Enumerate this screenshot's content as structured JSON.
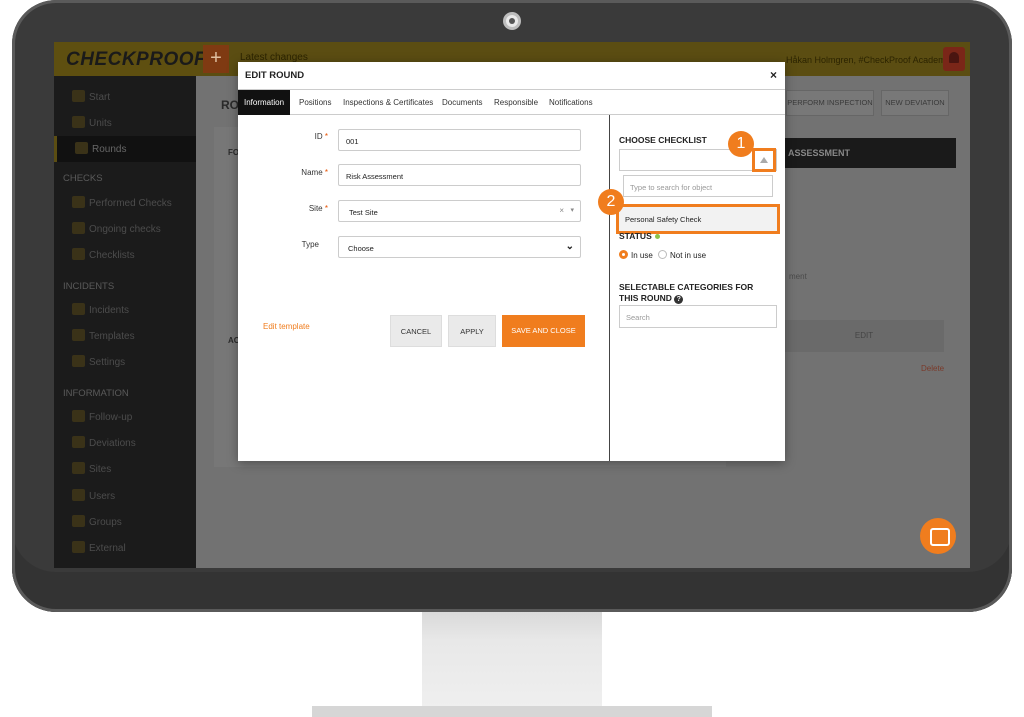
{
  "app": {
    "logo": "CHECKPROOF",
    "latest_changes": "Latest changes",
    "user": "Håkan Holmgren, #CheckProof Academy ▾",
    "plus": "+"
  },
  "sidebar": {
    "items": [
      {
        "label": "Start",
        "icon": "home-icon"
      },
      {
        "label": "Units",
        "icon": "truck-icon"
      },
      {
        "label": "Rounds",
        "icon": "route-icon"
      },
      {
        "label": "Performed Checks",
        "icon": "check-circle-icon"
      },
      {
        "label": "Ongoing checks",
        "icon": "clipboard-icon"
      },
      {
        "label": "Checklists",
        "icon": "list-icon"
      },
      {
        "label": "Incidents",
        "icon": "incident-icon"
      },
      {
        "label": "Templates",
        "icon": "template-icon"
      },
      {
        "label": "Settings",
        "icon": "settings-icon"
      },
      {
        "label": "Follow-up",
        "icon": "chart-icon"
      },
      {
        "label": "Deviations",
        "icon": "warning-icon"
      },
      {
        "label": "Sites",
        "icon": "globe-icon"
      },
      {
        "label": "Users",
        "icon": "user-icon"
      },
      {
        "label": "Groups",
        "icon": "group-icon"
      },
      {
        "label": "External",
        "icon": "external-icon"
      }
    ],
    "sections": {
      "checks": "CHECKS",
      "incidents": "INCIDENTS",
      "information": "INFORMATION"
    }
  },
  "background": {
    "title": "RO",
    "perform_inspection": "PERFORM INSPECTION",
    "new_deviation": "NEW DEVIATION",
    "assessment_header": "ASSESSMENT",
    "fo": "FO",
    "ac": "AC",
    "ment": "ment",
    "edit": "EDIT",
    "delete": "Delete"
  },
  "modal": {
    "title": "EDIT ROUND",
    "close": "×",
    "tabs": [
      "Information",
      "Positions",
      "Inspections & Certificates",
      "Documents",
      "Responsible",
      "Notifications"
    ],
    "fields": {
      "id_label": "ID",
      "id_value": "001",
      "name_label": "Name",
      "name_value": "Risk Assessment",
      "site_label": "Site",
      "site_value": "Test Site",
      "type_label": "Type",
      "type_value": "Choose",
      "required_mark": "*"
    },
    "edit_template": "Edit template",
    "cancel": "CANCEL",
    "apply": "APPLY",
    "save_close": "SAVE AND CLOSE",
    "right": {
      "choose_checklist": "CHOOSE CHECKLIST",
      "search_placeholder": "Type to search for object",
      "dropdown_item": "Personal Safety Check",
      "status": "STATUS",
      "in_use": "In use",
      "not_in_use": "Not in use",
      "categories": "SELECTABLE CATEGORIES FOR THIS ROUND",
      "categories_search": "Search"
    }
  },
  "callouts": [
    "1",
    "2"
  ],
  "colors": {
    "accent": "#f07d1e",
    "topbar": "#5b4d12",
    "sidebar": "#1b1b1b",
    "status_green": "#8bc34a"
  }
}
